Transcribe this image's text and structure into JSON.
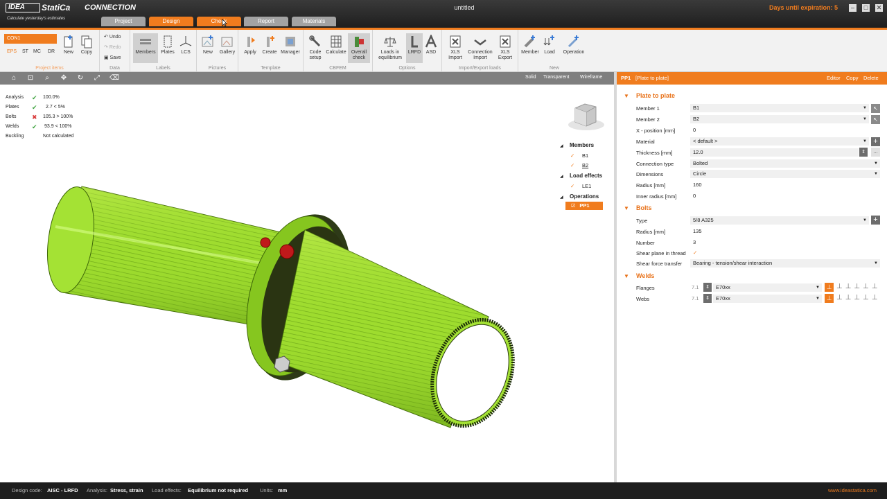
{
  "app": {
    "logo": "IDEA",
    "brand": "StatiCa",
    "tagline": "Calculate yesterday's estimates",
    "product": "CONNECTION",
    "doc_title": "untitled",
    "expiry": "Days until expiration: 5",
    "win_min": "–",
    "win_max": "□",
    "win_close": "✕"
  },
  "tabs": [
    "Project",
    "Design",
    "Check",
    "Report",
    "Materials"
  ],
  "ribbon": {
    "con": "CON1",
    "project_links": [
      "EPS",
      "ST",
      "MC",
      "DR"
    ],
    "project_buttons": [
      "New",
      "Copy"
    ],
    "project_label": "Project items",
    "data_cmds": [
      "Undo",
      "Redo",
      "Save"
    ],
    "data_label": "Data",
    "labels_btns": [
      "Members",
      "Plates",
      "LCS"
    ],
    "labels_label": "Labels",
    "pictures_btns": [
      "New",
      "Gallery"
    ],
    "pictures_label": "Pictures",
    "template_btns": [
      "Apply",
      "Create",
      "Manager"
    ],
    "template_label": "Template",
    "cbfem_btns": [
      "Code setup",
      "Calculate",
      "Overall check"
    ],
    "cbfem_label": "CBFEM",
    "options_btns": [
      "Loads in equilibrium",
      "LRFD",
      "ASD"
    ],
    "options_label": "Options",
    "import_btns": [
      "XLS Import",
      "Connection Import",
      "XLS Export"
    ],
    "import_label": "Import/Export loads",
    "new_btns": [
      "Member",
      "Load",
      "Operation"
    ],
    "new_label": "New"
  },
  "view_modes": [
    "Solid",
    "Transparent",
    "Wireframe"
  ],
  "checks": [
    {
      "label": "Analysis",
      "status": "ok",
      "value": "100.0%"
    },
    {
      "label": "Plates",
      "status": "ok",
      "value": "2.7 < 5%"
    },
    {
      "label": "Bolts",
      "status": "fail",
      "value": "105.3 > 100%"
    },
    {
      "label": "Welds",
      "status": "ok",
      "value": "93.9 < 100%"
    },
    {
      "label": "Buckling",
      "status": "none",
      "value": "Not calculated"
    }
  ],
  "tree": {
    "members": "Members",
    "b1": "B1",
    "b2": "B2",
    "loads": "Load effects",
    "le1": "LE1",
    "ops": "Operations",
    "pp1": "PP1"
  },
  "panel": {
    "id": "PP1",
    "name": "[Plate to plate]",
    "editor": "Editor",
    "copy": "Copy",
    "delete": "Delete",
    "sec1": "Plate to plate",
    "rows": [
      {
        "label": "Member 1",
        "value": "B1"
      },
      {
        "label": "Member 2",
        "value": "B2"
      },
      {
        "label": "X - position [mm]",
        "value": "0"
      },
      {
        "label": "Material",
        "value": "< default >"
      },
      {
        "label": "Thickness [mm]",
        "value": "12.0"
      },
      {
        "label": "Connection type",
        "value": "Bolted"
      },
      {
        "label": "Dimensions",
        "value": "Circle"
      },
      {
        "label": "Radius [mm]",
        "value": "160"
      },
      {
        "label": "Inner radius [mm]",
        "value": "0"
      }
    ],
    "sec2": "Bolts",
    "bolt_rows": [
      {
        "label": "Type",
        "value": "5/8 A325"
      },
      {
        "label": "Radius [mm]",
        "value": "135"
      },
      {
        "label": "Number",
        "value": "3"
      },
      {
        "label": "Shear plane in thread",
        "value": "✓"
      },
      {
        "label": "Shear force transfer",
        "value": "Bearing - tension/shear interaction"
      }
    ],
    "sec3": "Welds",
    "weld_rows": [
      {
        "label": "Flanges",
        "size": "7.1",
        "value": "E70xx"
      },
      {
        "label": "Webs",
        "size": "7.1",
        "value": "E70xx"
      }
    ]
  },
  "status": {
    "code_label": "Design code:",
    "code": "AISC - LRFD",
    "analysis_label": "Analysis:",
    "analysis": "Stress, strain",
    "loads_label": "Load effects:",
    "loads": "Equilibrium not required",
    "units_label": "Units:",
    "units": "mm",
    "site": "www.ideastatica.com"
  },
  "colors": {
    "accent": "#f07c1e",
    "member": "#9edc2e",
    "bolt": "#c0191b"
  }
}
